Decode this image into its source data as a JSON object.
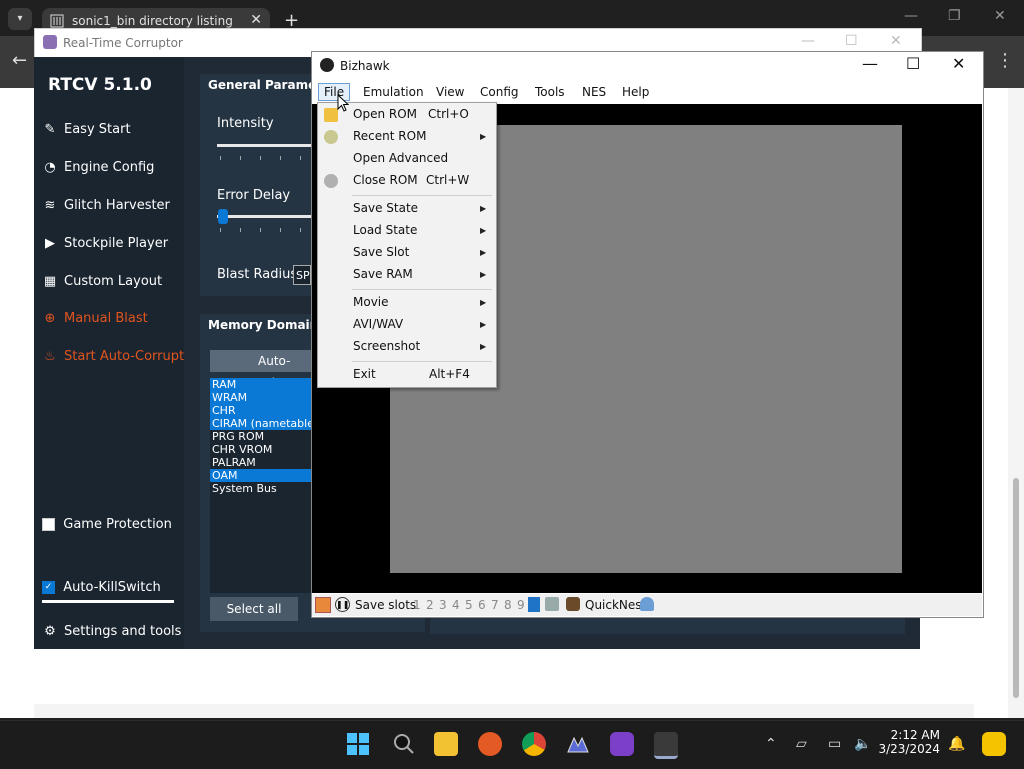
{
  "browser": {
    "tab_title": "sonic1_bin directory listing",
    "tab_close": "✕",
    "new_tab": "+",
    "tab_dropdown": "▾"
  },
  "rtc": {
    "window_title": "Real-Time Corruptor",
    "version": "RTCV 5.1.0",
    "sidebar": [
      {
        "label": "Easy Start",
        "icon": "wand-icon"
      },
      {
        "label": "Engine Config",
        "icon": "gauge-icon"
      },
      {
        "label": "Glitch Harvester",
        "icon": "layers-icon"
      },
      {
        "label": "Stockpile Player",
        "icon": "play-icon"
      },
      {
        "label": "Custom Layout",
        "icon": "grid-icon"
      },
      {
        "label": "Manual Blast",
        "icon": "crosshair-icon"
      },
      {
        "label": "Start Auto-Corrupt",
        "icon": "flame-icon"
      }
    ],
    "general_parameters": "General Parameters",
    "intensity_label": "Intensity",
    "error_delay_label": "Error Delay",
    "blast_radius_label": "Blast Radius:",
    "blast_radius_value": "SP",
    "memory_domains": "Memory Domains",
    "auto_select": "Auto-selec",
    "domains": [
      {
        "name": "RAM",
        "selected": true
      },
      {
        "name": "WRAM",
        "selected": true
      },
      {
        "name": "CHR",
        "selected": true
      },
      {
        "name": "CIRAM (nametables",
        "selected": true
      },
      {
        "name": "PRG ROM",
        "selected": false
      },
      {
        "name": "CHR VROM",
        "selected": false
      },
      {
        "name": "PALRAM",
        "selected": false
      },
      {
        "name": "OAM",
        "selected": true
      },
      {
        "name": "System Bus",
        "selected": false
      }
    ],
    "select_all": "Select all",
    "game_protection": "Game Protection",
    "auto_killswitch": "Auto-KillSwitch",
    "settings_and_tools": "Settings and tools"
  },
  "bizhawk": {
    "title": "Bizhawk",
    "menu": [
      "File",
      "Emulation",
      "View",
      "Config",
      "Tools",
      "NES",
      "Help"
    ],
    "file_menu": [
      {
        "label": "Open ROM",
        "shortcut": "Ctrl+O",
        "submenu": false
      },
      {
        "label": "Recent ROM",
        "shortcut": "",
        "submenu": true
      },
      {
        "label": "Open Advanced",
        "shortcut": "",
        "submenu": false
      },
      {
        "label": "Close ROM",
        "shortcut": "Ctrl+W",
        "submenu": false
      },
      {
        "label": "Save State",
        "shortcut": "",
        "submenu": true
      },
      {
        "label": "Load State",
        "shortcut": "",
        "submenu": true
      },
      {
        "label": "Save Slot",
        "shortcut": "",
        "submenu": true
      },
      {
        "label": "Save RAM",
        "shortcut": "",
        "submenu": true
      },
      {
        "label": "Movie",
        "shortcut": "",
        "submenu": true
      },
      {
        "label": "AVI/WAV",
        "shortcut": "",
        "submenu": true
      },
      {
        "label": "Screenshot",
        "shortcut": "",
        "submenu": true
      },
      {
        "label": "Exit",
        "shortcut": "Alt+F4",
        "submenu": false
      }
    ],
    "status": {
      "save_slots": "Save slots",
      "slots": [
        "1",
        "2",
        "3",
        "4",
        "5",
        "6",
        "7",
        "8",
        "9"
      ],
      "core": "QuickNes"
    }
  },
  "taskbar": {
    "time": "2:12 AM",
    "date": "3/23/2024",
    "apps": [
      "start-icon",
      "search-icon",
      "file-explorer-icon",
      "firefox-icon",
      "chrome-icon",
      "app-icon",
      "game-app-icon",
      "bizhawk-icon"
    ]
  },
  "colors": {
    "rtc_bg": "#1f2a36",
    "accent_red": "#e2541e",
    "select_blue": "#0a79d6"
  }
}
